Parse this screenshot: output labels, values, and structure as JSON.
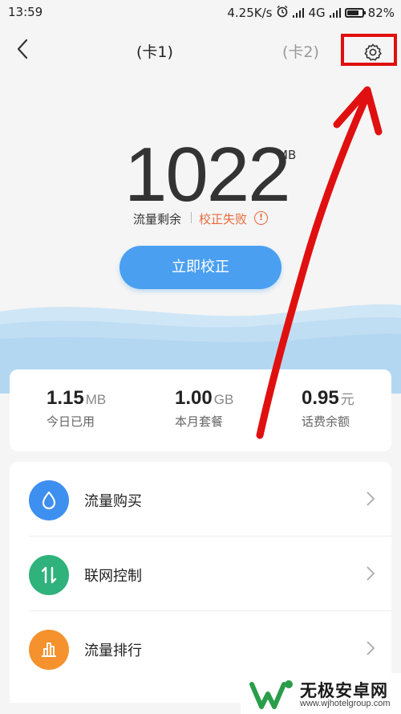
{
  "status_bar": {
    "time": "13:59",
    "speed": "4.25K/s",
    "network": "4G",
    "battery": "82%",
    "battery_level": 0.82,
    "icons": [
      "alarm-icon",
      "signal-icon",
      "signal-icon",
      "battery-icon"
    ]
  },
  "header": {
    "back_icon": "chevron-left-icon",
    "tab_card1": "(卡1)",
    "tab_card2": "(卡2)",
    "settings_icon": "gear-icon"
  },
  "remaining": {
    "value": "1022",
    "unit": "MB",
    "label": "流量剩余",
    "status": "校正失败",
    "status_icon": "exclamation-circle-icon",
    "calibrate_button": "立即校正"
  },
  "stats": [
    {
      "value": "1.15",
      "unit": "MB",
      "label": "今日已用"
    },
    {
      "value": "1.00",
      "unit": "GB",
      "label": "本月套餐"
    },
    {
      "value": "0.95",
      "unit": "元",
      "label": "话费余额"
    }
  ],
  "menu": [
    {
      "label": "流量购买",
      "icon": "droplet-icon",
      "color": "#3d8ff0"
    },
    {
      "label": "联网控制",
      "icon": "arrows-up-down-icon",
      "color": "#2fb27c"
    },
    {
      "label": "流量排行",
      "icon": "bar-chart-icon",
      "color": "#f5922e"
    }
  ],
  "watermark": {
    "title": "无极安卓网",
    "url": "www.wjhotelgroup.com"
  },
  "colors": {
    "accent": "#4a9ff0",
    "error": "#e86a3c",
    "annotation": "#e01010"
  }
}
